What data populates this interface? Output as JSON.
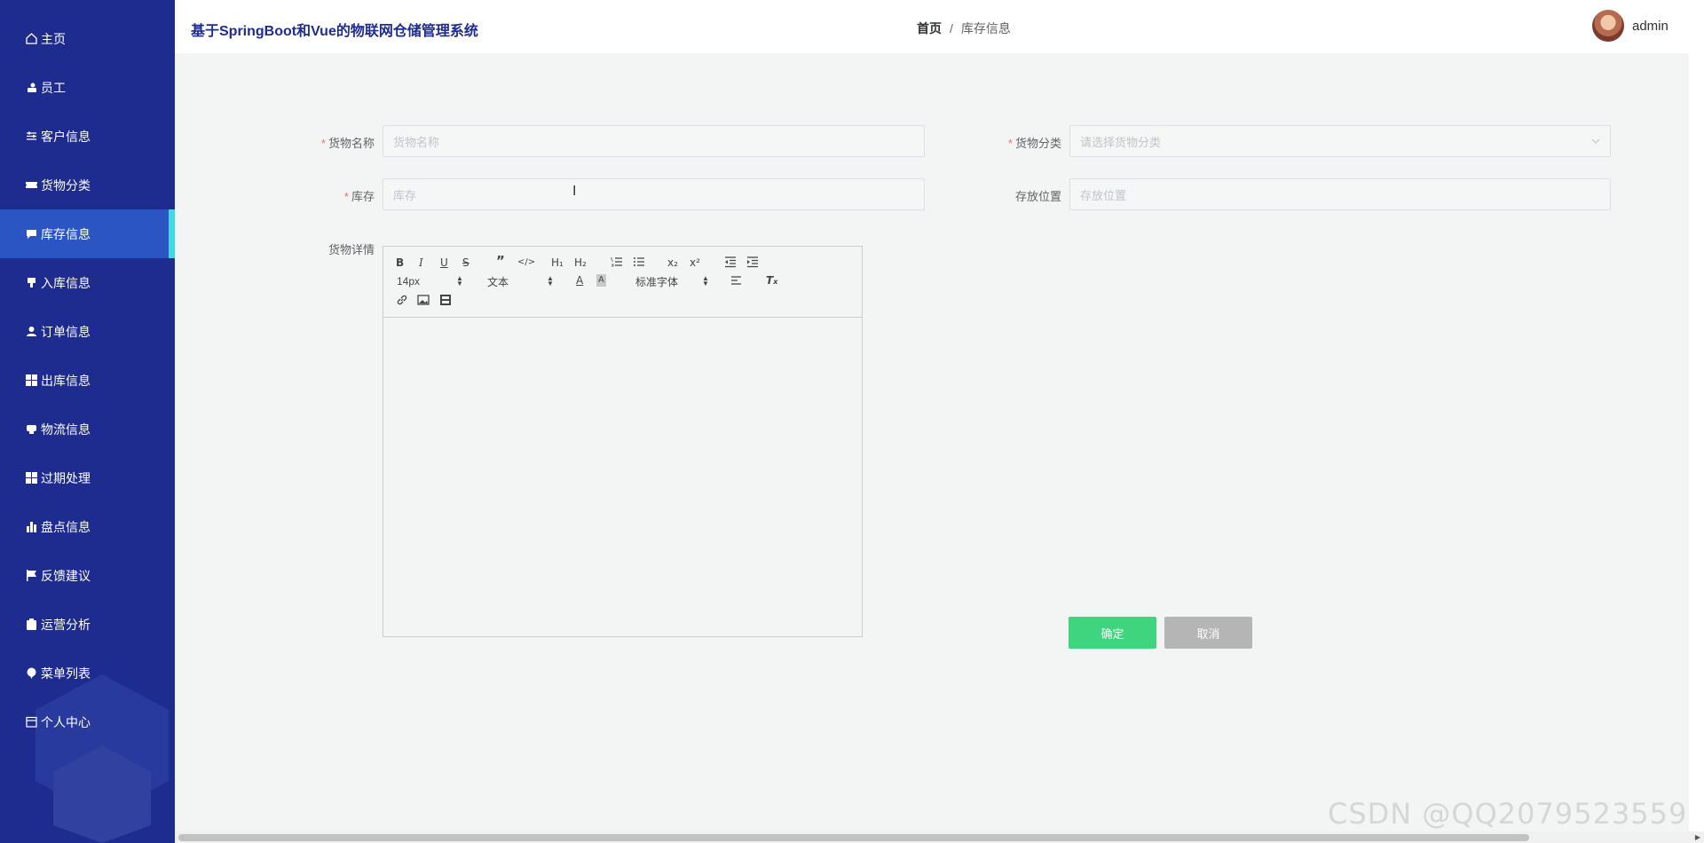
{
  "sidebar": {
    "items": [
      {
        "label": "主页",
        "icon": "home-icon"
      },
      {
        "label": "员工",
        "icon": "user-group-icon"
      },
      {
        "label": "客户信息",
        "icon": "sliders-icon"
      },
      {
        "label": "货物分类",
        "icon": "ticket-icon"
      },
      {
        "label": "库存信息",
        "icon": "chat-icon",
        "active": true
      },
      {
        "label": "入库信息",
        "icon": "download-icon"
      },
      {
        "label": "订单信息",
        "icon": "person-icon"
      },
      {
        "label": "出库信息",
        "icon": "grid-icon"
      },
      {
        "label": "物流信息",
        "icon": "message-icon"
      },
      {
        "label": "过期处理",
        "icon": "grid-icon"
      },
      {
        "label": "盘点信息",
        "icon": "bar-chart-icon"
      },
      {
        "label": "反馈建议",
        "icon": "flag-icon"
      },
      {
        "label": "运营分析",
        "icon": "clipboard-icon"
      },
      {
        "label": "菜单列表",
        "icon": "pin-icon"
      },
      {
        "label": "个人中心",
        "icon": "calendar-icon"
      }
    ]
  },
  "header": {
    "title": "基于SpringBoot和Vue的物联网仓储管理系统",
    "breadcrumb_home": "首页",
    "breadcrumb_sep": "/",
    "breadcrumb_current": "库存信息",
    "username": "admin"
  },
  "form": {
    "goods_name_label": "货物名称",
    "goods_name_placeholder": "货物名称",
    "category_label": "货物分类",
    "category_placeholder": "请选择货物分类",
    "stock_label": "库存",
    "stock_placeholder": "库存",
    "location_label": "存放位置",
    "location_placeholder": "存放位置",
    "detail_label": "货物详情",
    "required_mark": "*"
  },
  "editor": {
    "font_size": "14px",
    "header_select": "文本",
    "font_family": "标准字体"
  },
  "buttons": {
    "confirm": "确定",
    "cancel": "取消"
  },
  "watermark": "CSDN @QQ2079523559",
  "colors": {
    "sidebar_bg": "#1e2c8f",
    "active_item_bg": "#2a55c2",
    "active_indicator": "#41d8e4",
    "confirm_btn": "#3ed57e",
    "cancel_btn": "#b5b5b5"
  }
}
